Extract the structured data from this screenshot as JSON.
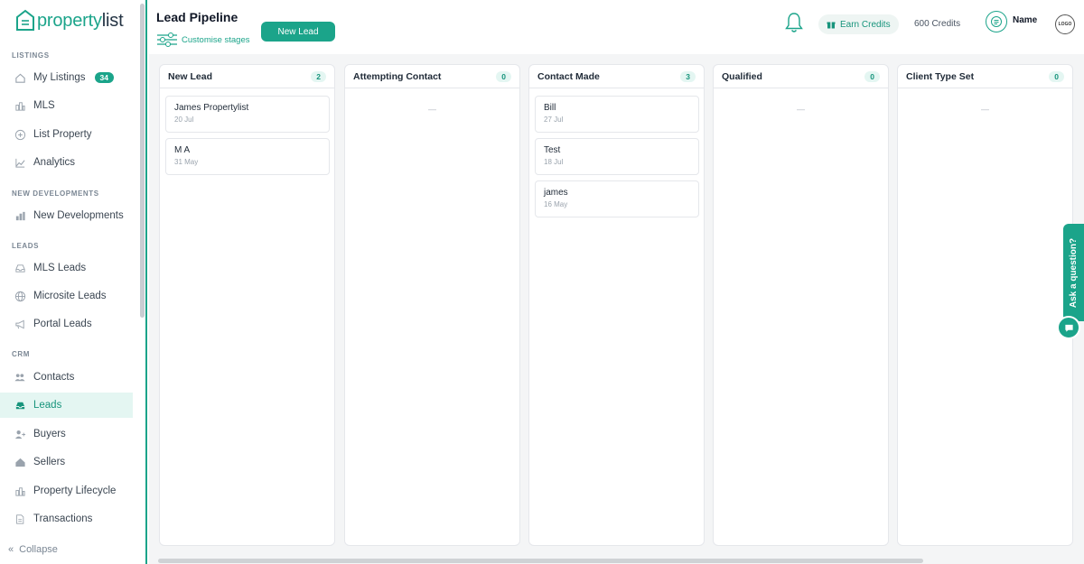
{
  "sidebar": {
    "logo": {
      "prefix": "property",
      "suffix": "list"
    },
    "sections": {
      "listings": "LISTINGS",
      "new_developments": "NEW DEVELOPMENTS",
      "leads": "LEADS",
      "crm": "CRM"
    },
    "items": {
      "my_listings": {
        "label": "My Listings",
        "badge": "34",
        "icon": "house-icon"
      },
      "mls": {
        "label": "MLS",
        "icon": "buildings-icon"
      },
      "list_property": {
        "label": "List Property",
        "icon": "plus-circle-icon"
      },
      "analytics": {
        "label": "Analytics",
        "icon": "trend-line-icon"
      },
      "new_developments": {
        "label": "New Developments",
        "icon": "bar-buildings-icon"
      },
      "mls_leads": {
        "label": "MLS Leads",
        "icon": "inbox-icon"
      },
      "microsite_leads": {
        "label": "Microsite Leads",
        "icon": "globe-icon"
      },
      "portal_leads": {
        "label": "Portal Leads",
        "icon": "megaphone-icon"
      },
      "contacts": {
        "label": "Contacts",
        "icon": "people-icon"
      },
      "leads": {
        "label": "Leads",
        "icon": "inbox-icon",
        "active": true
      },
      "buyers": {
        "label": "Buyers",
        "icon": "user-plus-icon"
      },
      "sellers": {
        "label": "Sellers",
        "icon": "house-dollar-icon"
      },
      "property_lifecycle": {
        "label": "Property Lifecycle",
        "icon": "buildings-icon"
      },
      "transactions": {
        "label": "Transactions",
        "icon": "document-icon"
      }
    },
    "collapse": "Collapse"
  },
  "header": {
    "title": "Lead Pipeline",
    "customise": "Customise stages",
    "new_lead": "New Lead",
    "earn_credits": "Earn Credits",
    "credits": "600 Credits",
    "user_name": "Name",
    "brand": "LOGO"
  },
  "board": {
    "columns": [
      {
        "title": "New Lead",
        "count": "2",
        "cards": [
          {
            "name": "James Propertylist",
            "date": "20 Jul"
          },
          {
            "name": "M A",
            "date": "31 May"
          }
        ]
      },
      {
        "title": "Attempting Contact",
        "count": "0",
        "empty": "—"
      },
      {
        "title": "Contact Made",
        "count": "3",
        "cards": [
          {
            "name": "Bill",
            "date": "27 Jul"
          },
          {
            "name": "Test",
            "date": "18 Jul"
          },
          {
            "name": "james",
            "date": "16 May"
          }
        ]
      },
      {
        "title": "Qualified",
        "count": "0",
        "empty": "—"
      },
      {
        "title": "Client Type Set",
        "count": "0",
        "empty": "—"
      }
    ]
  },
  "help": {
    "ask": "Ask a question?"
  },
  "colors": {
    "accent": "#1ba48a",
    "active_bg": "#e4f6f2"
  }
}
